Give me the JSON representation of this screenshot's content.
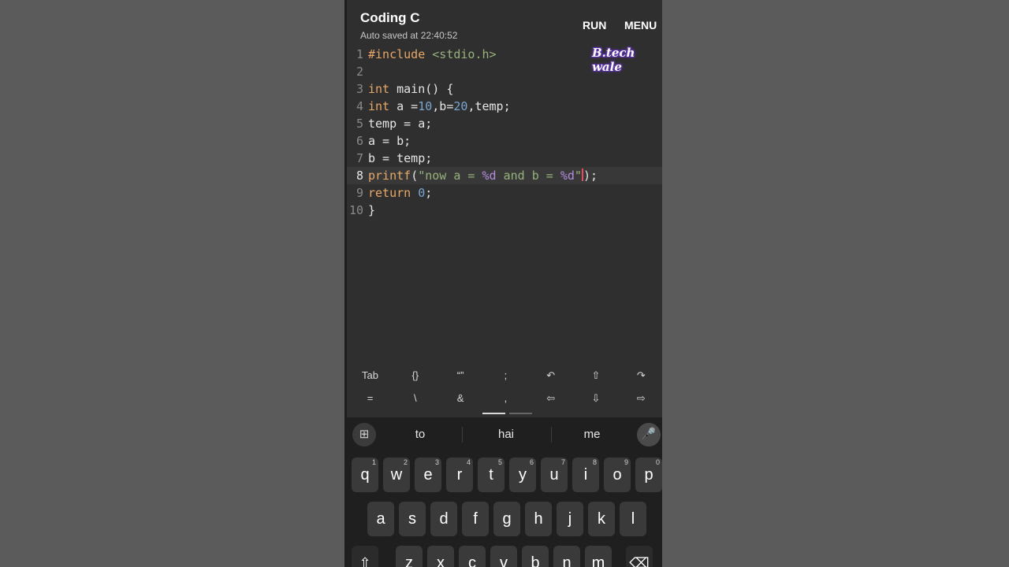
{
  "header": {
    "title": "Coding C",
    "subtitle": "Auto saved at 22:40:52",
    "run_label": "RUN",
    "menu_label": "MENU"
  },
  "watermark": "B.tech wale",
  "editor": {
    "line_numbers": [
      "1",
      "2",
      "3",
      "4",
      "5",
      "6",
      "7",
      "8",
      "9",
      "10"
    ],
    "active_line": 8,
    "lines": [
      [
        {
          "t": "#include ",
          "c": "kw"
        },
        {
          "t": "<stdio.h>",
          "c": "str"
        }
      ],
      [],
      [
        {
          "t": "int",
          "c": "kw"
        },
        {
          "t": " main() {",
          "c": "txt"
        }
      ],
      [
        {
          "t": "int",
          "c": "kw"
        },
        {
          "t": " a =",
          "c": "txt"
        },
        {
          "t": "10",
          "c": "num"
        },
        {
          "t": ",b=",
          "c": "txt"
        },
        {
          "t": "20",
          "c": "num"
        },
        {
          "t": ",temp;",
          "c": "txt"
        }
      ],
      [
        {
          "t": "temp = a;",
          "c": "txt"
        }
      ],
      [
        {
          "t": "a = b;",
          "c": "txt"
        }
      ],
      [
        {
          "t": "b = temp;",
          "c": "txt"
        }
      ],
      [
        {
          "t": "printf",
          "c": "fn"
        },
        {
          "t": "(",
          "c": "txt"
        },
        {
          "t": "\"now a = ",
          "c": "str"
        },
        {
          "t": "%d",
          "c": "fmt"
        },
        {
          "t": " and b = ",
          "c": "str"
        },
        {
          "t": "%d",
          "c": "fmt"
        },
        {
          "t": "\"",
          "c": "str"
        },
        {
          "t": "|",
          "c": "cursor"
        },
        {
          "t": ");",
          "c": "txt"
        }
      ],
      [
        {
          "t": "return",
          "c": "kw"
        },
        {
          "t": " ",
          "c": "txt"
        },
        {
          "t": "0",
          "c": "num"
        },
        {
          "t": ";",
          "c": "txt"
        }
      ],
      [
        {
          "t": "}",
          "c": "txt"
        }
      ]
    ]
  },
  "extra_keys": {
    "row1": [
      "Tab",
      "{}",
      "“”",
      ";",
      "↶",
      "⇧",
      "↷"
    ],
    "row2": [
      "=",
      "\\",
      "&",
      ",",
      "⇦",
      "⇩",
      "⇨"
    ]
  },
  "keyboard": {
    "suggestions": [
      "to",
      "hai",
      "me"
    ],
    "grid_icon": "⊞",
    "mic_icon": "🎤",
    "row1": [
      {
        "k": "q",
        "s": "1"
      },
      {
        "k": "w",
        "s": "2"
      },
      {
        "k": "e",
        "s": "3"
      },
      {
        "k": "r",
        "s": "4"
      },
      {
        "k": "t",
        "s": "5"
      },
      {
        "k": "y",
        "s": "6"
      },
      {
        "k": "u",
        "s": "7"
      },
      {
        "k": "i",
        "s": "8"
      },
      {
        "k": "o",
        "s": "9"
      },
      {
        "k": "p",
        "s": "0"
      }
    ],
    "row2": [
      "a",
      "s",
      "d",
      "f",
      "g",
      "h",
      "j",
      "k",
      "l"
    ],
    "row3": [
      "⇧",
      "z",
      "x",
      "c",
      "v",
      "b",
      "n",
      "m",
      "⌫"
    ]
  },
  "colors": {
    "background": "#5b5b5b",
    "editor_bg": "#2f2f2f",
    "keyword": "#e8a868",
    "string": "#97b27a",
    "number": "#79a6d2",
    "format": "#b58be0",
    "cursor": "#e84a5f"
  }
}
